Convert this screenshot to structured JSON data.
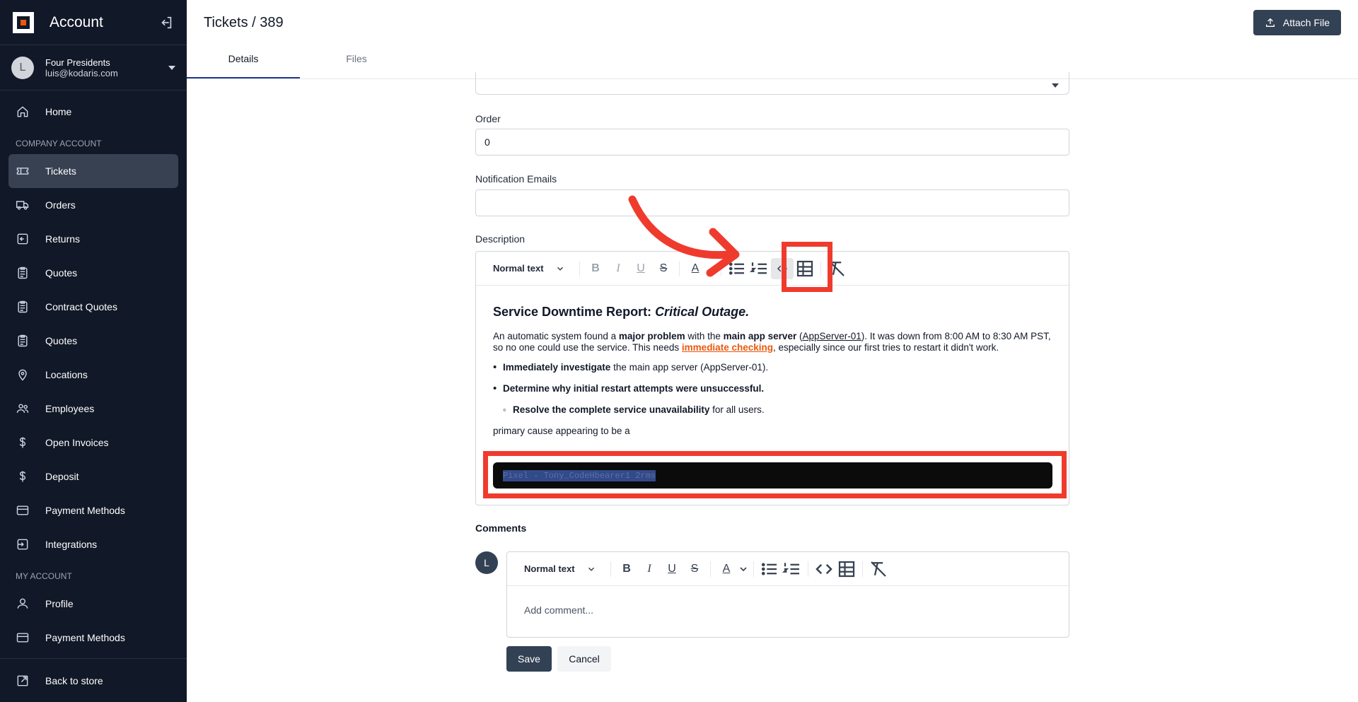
{
  "sidebar": {
    "title": "Account",
    "user": {
      "initial": "L",
      "name": "Four Presidents",
      "email": "luis@kodaris.com"
    },
    "home": "Home",
    "section_company": "COMPANY ACCOUNT",
    "company_items": [
      {
        "label": "Tickets",
        "icon": "ticket-icon",
        "active": true
      },
      {
        "label": "Orders",
        "icon": "truck-icon"
      },
      {
        "label": "Returns",
        "icon": "return-icon"
      },
      {
        "label": "Quotes",
        "icon": "clipboard-icon"
      },
      {
        "label": "Contract Quotes",
        "icon": "clipboard-icon"
      },
      {
        "label": "Quotes",
        "icon": "clipboard-icon"
      },
      {
        "label": "Locations",
        "icon": "map-pin-icon"
      },
      {
        "label": "Employees",
        "icon": "users-icon"
      },
      {
        "label": "Open Invoices",
        "icon": "dollar-icon"
      },
      {
        "label": "Deposit",
        "icon": "dollar-icon"
      },
      {
        "label": "Payment Methods",
        "icon": "credit-card-icon"
      },
      {
        "label": "Integrations",
        "icon": "integration-icon"
      }
    ],
    "section_my": "MY ACCOUNT",
    "my_items": [
      {
        "label": "Profile",
        "icon": "user-icon"
      },
      {
        "label": "Payment Methods",
        "icon": "credit-card-icon"
      }
    ],
    "back_to_store": "Back to store"
  },
  "header": {
    "title": "Tickets / 389",
    "attach_label": "Attach File",
    "tabs": [
      {
        "label": "Details",
        "active": true
      },
      {
        "label": "Files"
      }
    ]
  },
  "form": {
    "order_label": "Order",
    "order_value": "0",
    "notify_label": "Notification Emails",
    "notify_value": "",
    "description_label": "Description"
  },
  "editor": {
    "style_select": "Normal text",
    "heading_plain": "Service Downtime Report: ",
    "heading_italic": "Critical Outage.",
    "p1": {
      "t1": "An automatic system found a ",
      "b1": "major problem",
      "t2": " with the ",
      "b2": "main app server",
      "t3": " (",
      "u1": "AppServer-01",
      "t4": "). It was down from 8:00 AM to 8:30 AM PST, so no one could use the service. This needs ",
      "hl": "immediate checking",
      "t5": ", especially since our first tries to restart it didn't work."
    },
    "li1_bold": "Immediately investigate",
    "li1_rest": " the main app server (AppServer-01).",
    "li2_bold": "Determine why initial restart attempts were unsuccessful.",
    "li3_bold": "Resolve the complete service unavailability",
    "li3_rest": " for all users.",
    "p2": "primary cause appearing to be a",
    "code_text": "Pixel - Tony_CodeHbearer1 2rms"
  },
  "comments": {
    "label": "Comments",
    "avatar_initial": "L",
    "style_select": "Normal text",
    "placeholder": "Add comment...",
    "save": "Save",
    "cancel": "Cancel"
  },
  "colors": {
    "sidebar_bg": "#111827",
    "primary": "#334155",
    "highlight": "#ea580c",
    "annotation": "#ef3b2d"
  }
}
